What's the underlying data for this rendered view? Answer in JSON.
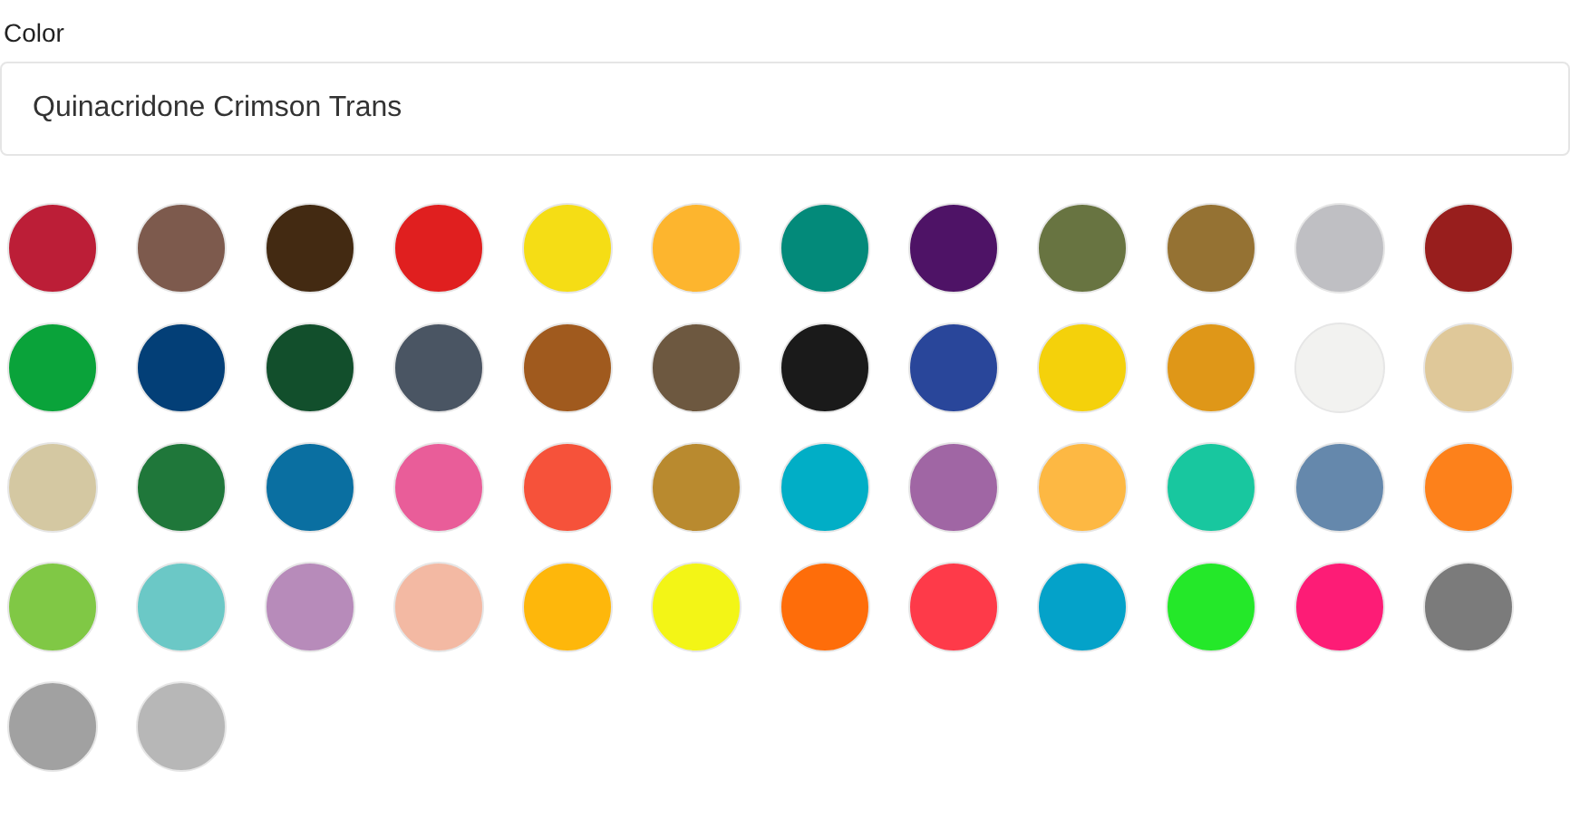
{
  "field": {
    "label": "Color",
    "value": "Quinacridone Crimson Trans"
  },
  "swatches": [
    {
      "color": "#bc1e37"
    },
    {
      "color": "#7d5a4d"
    },
    {
      "color": "#432a12"
    },
    {
      "color": "#e01f1f"
    },
    {
      "color": "#f5dd15"
    },
    {
      "color": "#fdb52e"
    },
    {
      "color": "#038a7a"
    },
    {
      "color": "#4e1366"
    },
    {
      "color": "#687441"
    },
    {
      "color": "#957233"
    },
    {
      "color": "#bfbfc3"
    },
    {
      "color": "#981e1d"
    },
    {
      "color": "#0aa33a"
    },
    {
      "color": "#033f77"
    },
    {
      "color": "#124f2c"
    },
    {
      "color": "#4a5563"
    },
    {
      "color": "#a05a1e"
    },
    {
      "color": "#6d5840"
    },
    {
      "color": "#1a1a1a"
    },
    {
      "color": "#29469a"
    },
    {
      "color": "#f4d10b"
    },
    {
      "color": "#df9718"
    },
    {
      "color": "#f2f2f0"
    },
    {
      "color": "#dfc899"
    },
    {
      "color": "#d4c8a2"
    },
    {
      "color": "#1f773a"
    },
    {
      "color": "#0a6fa1"
    },
    {
      "color": "#e95d99"
    },
    {
      "color": "#f6523a"
    },
    {
      "color": "#b98a2f"
    },
    {
      "color": "#01aec6"
    },
    {
      "color": "#a066a4"
    },
    {
      "color": "#fdb843"
    },
    {
      "color": "#18c79f"
    },
    {
      "color": "#6588ac"
    },
    {
      "color": "#fd811b"
    },
    {
      "color": "#80c845"
    },
    {
      "color": "#6bc8c6"
    },
    {
      "color": "#b78bba"
    },
    {
      "color": "#f3b9a3"
    },
    {
      "color": "#feb70b"
    },
    {
      "color": "#f3f516"
    },
    {
      "color": "#fe6d0a"
    },
    {
      "color": "#fe3a49"
    },
    {
      "color": "#04a2c9"
    },
    {
      "color": "#24e829"
    },
    {
      "color": "#fd1c76"
    },
    {
      "color": "#7b7b7b"
    },
    {
      "color": "#a1a1a1"
    },
    {
      "color": "#b7b7b7"
    }
  ]
}
